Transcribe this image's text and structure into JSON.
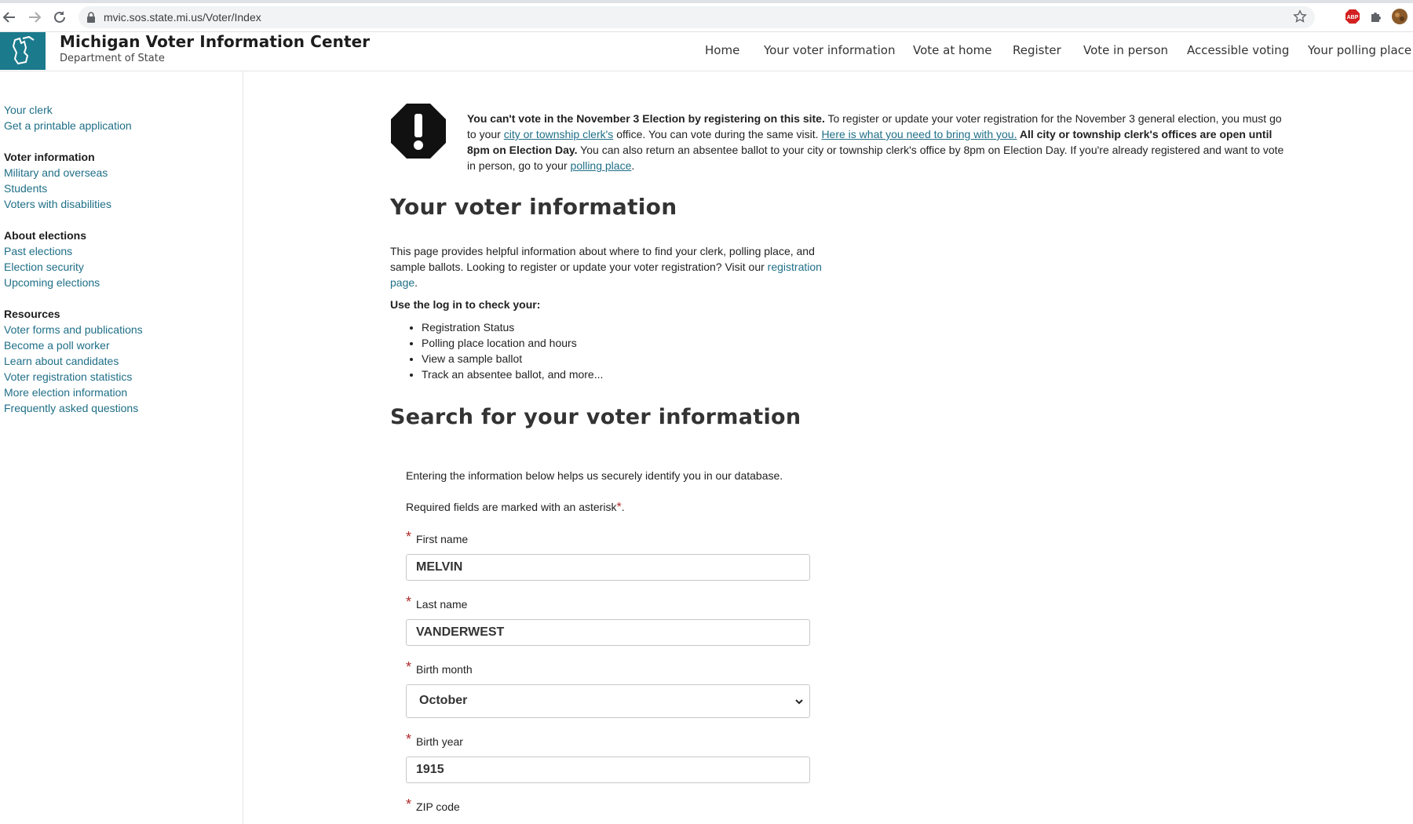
{
  "browser": {
    "url": "mvic.sos.state.mi.us/Voter/Index"
  },
  "header": {
    "title": "Michigan Voter Information Center",
    "subtitle": "Department of State",
    "nav": [
      "Home",
      "Your voter information",
      "Vote at home",
      "Register",
      "Vote in person",
      "Accessible voting",
      "Your polling place"
    ]
  },
  "sidebar": {
    "top_links": [
      "Your clerk",
      "Get a printable application"
    ],
    "sections": [
      {
        "heading": "Voter information",
        "links": [
          "Military and overseas",
          "Students",
          "Voters with disabilities"
        ]
      },
      {
        "heading": "About elections",
        "links": [
          "Past elections",
          "Election security",
          "Upcoming elections"
        ]
      },
      {
        "heading": "Resources",
        "links": [
          "Voter forms and publications",
          "Become a poll worker",
          "Learn about candidates",
          "Voter registration statistics",
          "More election information",
          "Frequently asked questions"
        ]
      }
    ]
  },
  "alert": {
    "bold_lead": "You can't vote in the November 3 Election by registering on this site.",
    "text1": " To register or update your voter registration for the November 3 general election, you must go to your ",
    "link1": "city or township clerk's",
    "text2": " office. You can vote during the same visit. ",
    "link2": " Here is what you need to bring with you.",
    "bold2": " All city or township clerk's offices are open until 8pm on Election Day.",
    "text3": " You can also return an absentee ballot to your city or township clerk's office by 8pm on Election Day. If you're already registered and want to vote in person, go to your ",
    "link3": "polling place",
    "text4": "."
  },
  "main": {
    "title": "Your voter information",
    "intro_text": "This page provides helpful information about where to find your clerk, polling place, and sample ballots. Looking to register or update your voter registration? Visit our ",
    "intro_link": "registration page",
    "intro_end": ".",
    "use_login": "Use the log in to check your:",
    "checklist": [
      "Registration Status",
      "Polling place location and hours",
      "View a sample ballot",
      "Track an absentee ballot, and more..."
    ]
  },
  "search": {
    "title": "Search for your voter information",
    "note1": "Entering the information below helps us securely identify you in our database.",
    "note2": "Required fields are marked with an asterisk",
    "asterisk": "*",
    "fields": {
      "first_name_label": "First name",
      "first_name_value": "MELVIN",
      "last_name_label": "Last name",
      "last_name_value": "VANDERWEST",
      "birth_month_label": "Birth month",
      "birth_month_value": "October",
      "birth_year_label": "Birth year",
      "birth_year_value": "1915",
      "zip_label": "ZIP code"
    }
  }
}
